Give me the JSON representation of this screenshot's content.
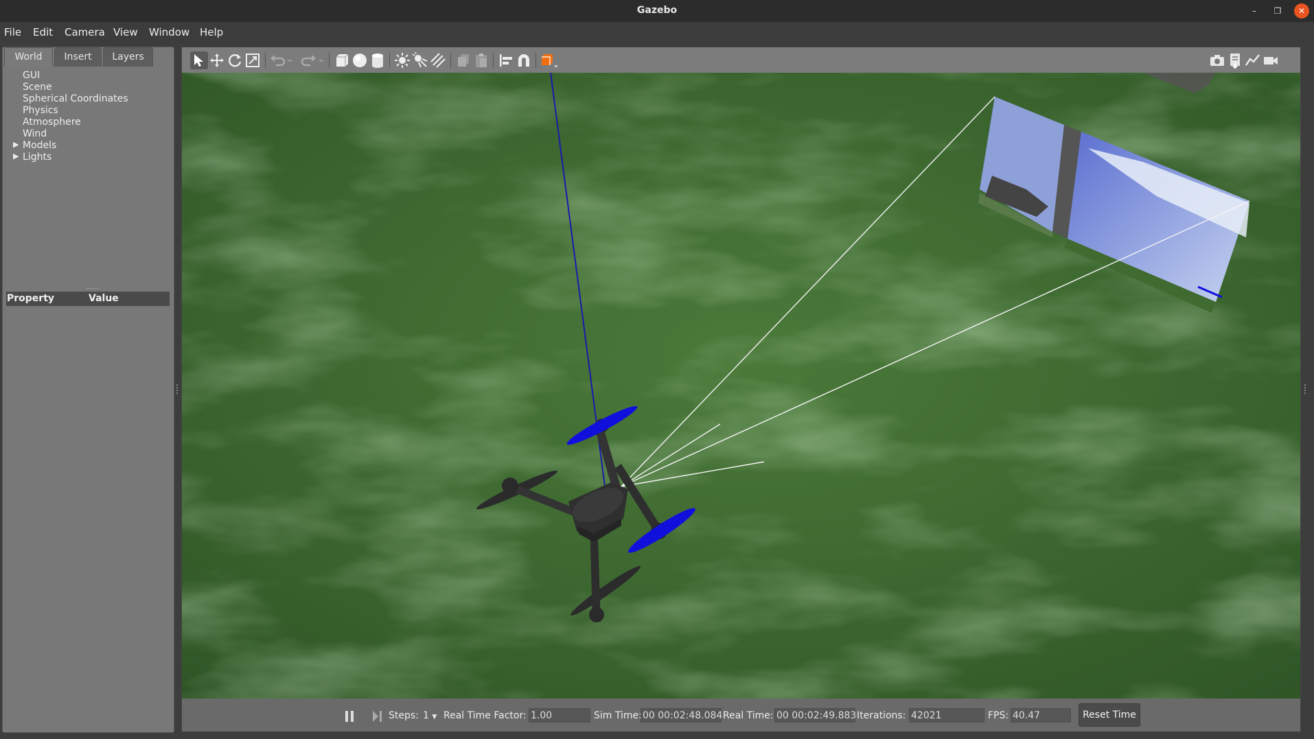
{
  "window": {
    "title": "Gazebo"
  },
  "menu": [
    "File",
    "Edit",
    "Camera",
    "View",
    "Window",
    "Help"
  ],
  "left_tabs": [
    "World",
    "Insert",
    "Layers"
  ],
  "tree": [
    {
      "label": "GUI",
      "expandable": false
    },
    {
      "label": "Scene",
      "expandable": false
    },
    {
      "label": "Spherical Coordinates",
      "expandable": false
    },
    {
      "label": "Physics",
      "expandable": false
    },
    {
      "label": "Atmosphere",
      "expandable": false
    },
    {
      "label": "Wind",
      "expandable": false
    },
    {
      "label": "Models",
      "expandable": true
    },
    {
      "label": "Lights",
      "expandable": true
    }
  ],
  "property_table": {
    "col_property": "Property",
    "col_value": "Value"
  },
  "toolbar": {
    "left": [
      "select-mode-icon",
      "translate-mode-icon",
      "rotate-mode-icon",
      "scale-mode-icon",
      "undo-icon",
      "undo-history-icon",
      "redo-icon",
      "redo-history-icon",
      "box-icon",
      "sphere-icon",
      "cylinder-icon",
      "point-light-icon",
      "spot-light-icon",
      "directional-light-icon",
      "copy-icon",
      "paste-icon",
      "align-icon",
      "snap-icon",
      "change-view-icon"
    ],
    "right": [
      "screenshot-icon",
      "log-icon",
      "plot-icon",
      "record-video-icon"
    ]
  },
  "status": {
    "steps_label": "Steps:",
    "steps_value": "1",
    "rtf_label": "Real Time Factor:",
    "rtf_value": "1.00",
    "sim_time_label": "Sim Time:",
    "sim_time_value": "00 00:02:48.084",
    "real_time_label": "Real Time:",
    "real_time_value": "00 00:02:49.883",
    "iterations_label": "Iterations:",
    "iterations_value": "42021",
    "fps_label": "FPS:",
    "fps_value": "40.47",
    "reset_label": "Reset Time"
  },
  "colors": {
    "ground": "#3f6a30",
    "propeller": "#1010dd",
    "accent_close": "#e95420"
  }
}
